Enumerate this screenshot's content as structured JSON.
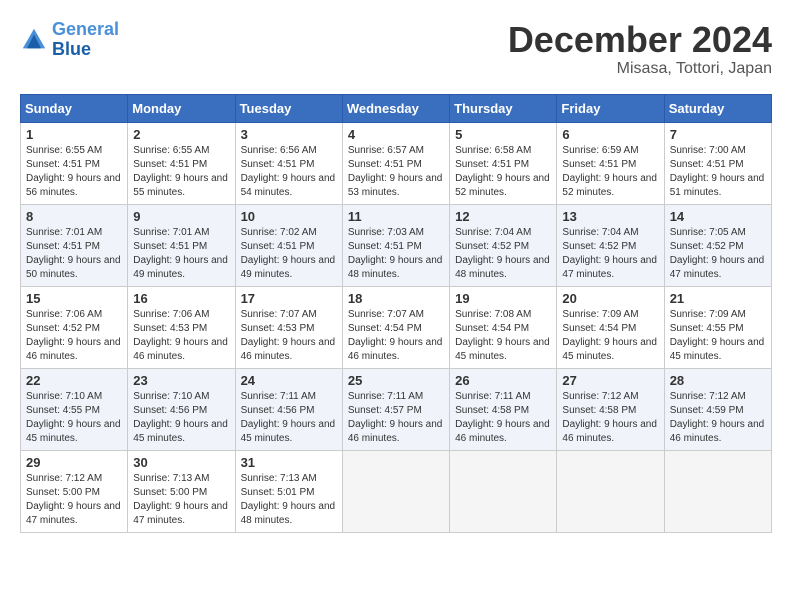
{
  "header": {
    "logo_line1": "General",
    "logo_line2": "Blue",
    "month": "December 2024",
    "location": "Misasa, Tottori, Japan"
  },
  "weekdays": [
    "Sunday",
    "Monday",
    "Tuesday",
    "Wednesday",
    "Thursday",
    "Friday",
    "Saturday"
  ],
  "weeks": [
    [
      {
        "day": "1",
        "sunrise": "6:55 AM",
        "sunset": "4:51 PM",
        "daylight": "9 hours and 56 minutes."
      },
      {
        "day": "2",
        "sunrise": "6:55 AM",
        "sunset": "4:51 PM",
        "daylight": "9 hours and 55 minutes."
      },
      {
        "day": "3",
        "sunrise": "6:56 AM",
        "sunset": "4:51 PM",
        "daylight": "9 hours and 54 minutes."
      },
      {
        "day": "4",
        "sunrise": "6:57 AM",
        "sunset": "4:51 PM",
        "daylight": "9 hours and 53 minutes."
      },
      {
        "day": "5",
        "sunrise": "6:58 AM",
        "sunset": "4:51 PM",
        "daylight": "9 hours and 52 minutes."
      },
      {
        "day": "6",
        "sunrise": "6:59 AM",
        "sunset": "4:51 PM",
        "daylight": "9 hours and 52 minutes."
      },
      {
        "day": "7",
        "sunrise": "7:00 AM",
        "sunset": "4:51 PM",
        "daylight": "9 hours and 51 minutes."
      }
    ],
    [
      {
        "day": "8",
        "sunrise": "7:01 AM",
        "sunset": "4:51 PM",
        "daylight": "9 hours and 50 minutes."
      },
      {
        "day": "9",
        "sunrise": "7:01 AM",
        "sunset": "4:51 PM",
        "daylight": "9 hours and 49 minutes."
      },
      {
        "day": "10",
        "sunrise": "7:02 AM",
        "sunset": "4:51 PM",
        "daylight": "9 hours and 49 minutes."
      },
      {
        "day": "11",
        "sunrise": "7:03 AM",
        "sunset": "4:51 PM",
        "daylight": "9 hours and 48 minutes."
      },
      {
        "day": "12",
        "sunrise": "7:04 AM",
        "sunset": "4:52 PM",
        "daylight": "9 hours and 48 minutes."
      },
      {
        "day": "13",
        "sunrise": "7:04 AM",
        "sunset": "4:52 PM",
        "daylight": "9 hours and 47 minutes."
      },
      {
        "day": "14",
        "sunrise": "7:05 AM",
        "sunset": "4:52 PM",
        "daylight": "9 hours and 47 minutes."
      }
    ],
    [
      {
        "day": "15",
        "sunrise": "7:06 AM",
        "sunset": "4:52 PM",
        "daylight": "9 hours and 46 minutes."
      },
      {
        "day": "16",
        "sunrise": "7:06 AM",
        "sunset": "4:53 PM",
        "daylight": "9 hours and 46 minutes."
      },
      {
        "day": "17",
        "sunrise": "7:07 AM",
        "sunset": "4:53 PM",
        "daylight": "9 hours and 46 minutes."
      },
      {
        "day": "18",
        "sunrise": "7:07 AM",
        "sunset": "4:54 PM",
        "daylight": "9 hours and 46 minutes."
      },
      {
        "day": "19",
        "sunrise": "7:08 AM",
        "sunset": "4:54 PM",
        "daylight": "9 hours and 45 minutes."
      },
      {
        "day": "20",
        "sunrise": "7:09 AM",
        "sunset": "4:54 PM",
        "daylight": "9 hours and 45 minutes."
      },
      {
        "day": "21",
        "sunrise": "7:09 AM",
        "sunset": "4:55 PM",
        "daylight": "9 hours and 45 minutes."
      }
    ],
    [
      {
        "day": "22",
        "sunrise": "7:10 AM",
        "sunset": "4:55 PM",
        "daylight": "9 hours and 45 minutes."
      },
      {
        "day": "23",
        "sunrise": "7:10 AM",
        "sunset": "4:56 PM",
        "daylight": "9 hours and 45 minutes."
      },
      {
        "day": "24",
        "sunrise": "7:11 AM",
        "sunset": "4:56 PM",
        "daylight": "9 hours and 45 minutes."
      },
      {
        "day": "25",
        "sunrise": "7:11 AM",
        "sunset": "4:57 PM",
        "daylight": "9 hours and 46 minutes."
      },
      {
        "day": "26",
        "sunrise": "7:11 AM",
        "sunset": "4:58 PM",
        "daylight": "9 hours and 46 minutes."
      },
      {
        "day": "27",
        "sunrise": "7:12 AM",
        "sunset": "4:58 PM",
        "daylight": "9 hours and 46 minutes."
      },
      {
        "day": "28",
        "sunrise": "7:12 AM",
        "sunset": "4:59 PM",
        "daylight": "9 hours and 46 minutes."
      }
    ],
    [
      {
        "day": "29",
        "sunrise": "7:12 AM",
        "sunset": "5:00 PM",
        "daylight": "9 hours and 47 minutes."
      },
      {
        "day": "30",
        "sunrise": "7:13 AM",
        "sunset": "5:00 PM",
        "daylight": "9 hours and 47 minutes."
      },
      {
        "day": "31",
        "sunrise": "7:13 AM",
        "sunset": "5:01 PM",
        "daylight": "9 hours and 48 minutes."
      },
      null,
      null,
      null,
      null
    ]
  ]
}
